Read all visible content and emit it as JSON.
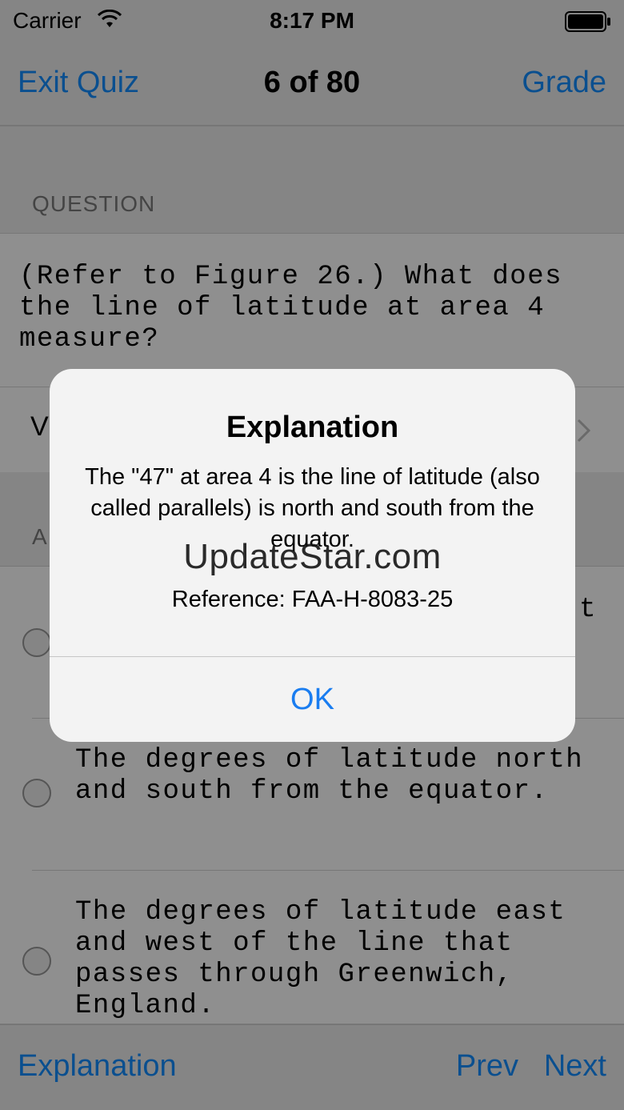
{
  "status_bar": {
    "carrier": "Carrier",
    "time": "8:17 PM"
  },
  "nav": {
    "left_label": "Exit Quiz",
    "title": "6 of 80",
    "right_label": "Grade"
  },
  "question": {
    "header": "QUESTION",
    "text": "(Refer to Figure 26.) What does the line of latitude at area 4 measure?",
    "view_label": "V"
  },
  "answers": {
    "header": "A",
    "options": [
      {
        "text": "t"
      },
      {
        "text": "The degrees of latitude north and south from the equator."
      },
      {
        "text": "The degrees of latitude east and west of the line that passes through Greenwich, England."
      }
    ]
  },
  "toolbar": {
    "explanation_label": "Explanation",
    "prev_label": "Prev",
    "next_label": "Next"
  },
  "alert": {
    "title": "Explanation",
    "message": "The \"47\" at area 4 is the line of latitude (also called parallels) is north and south from the equator.",
    "reference": "Reference: FAA-H-8083-25",
    "ok_label": "OK"
  },
  "watermark": "UpdateStar.com",
  "colors": {
    "accent": "#1a7df0",
    "dimmed_accent": "#0a4f8f",
    "overlay_bg": "#8f8f8f",
    "alert_bg": "#f3f3f3"
  },
  "icons": {
    "wifi": "wifi-icon",
    "battery": "battery-icon",
    "chevron": "chevron-right-icon",
    "radio": "radio-unselected-icon"
  }
}
